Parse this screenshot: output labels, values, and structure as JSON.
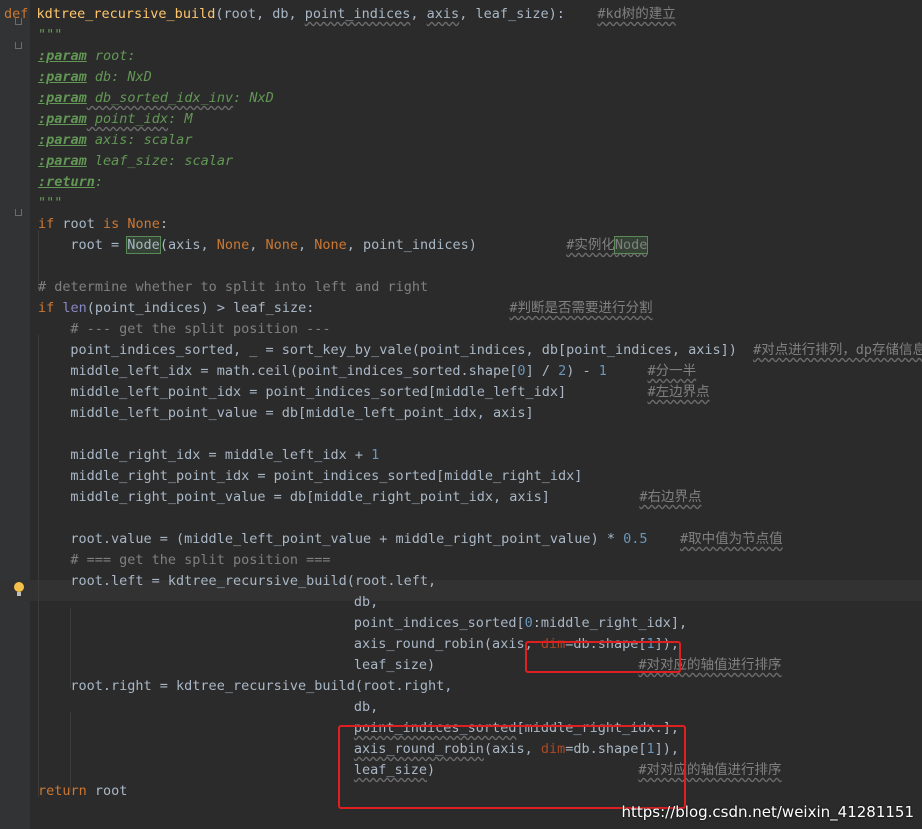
{
  "watermark": "https://blog.csdn.net/weixin_41281151",
  "lines": [
    {
      "id": "def-line",
      "row": 0,
      "indent": 0,
      "segs": [
        {
          "t": "def ",
          "c": "k"
        },
        {
          "t": "kdtree_recursive_build",
          "c": "fn"
        },
        {
          "t": "(root, db, "
        },
        {
          "t": "point_indices",
          "c": "u"
        },
        {
          "t": ", "
        },
        {
          "t": "axis",
          "c": "u"
        },
        {
          "t": ", leaf_size):    "
        },
        {
          "t": "#kd树的建立",
          "c": "cn"
        }
      ]
    },
    {
      "id": "doc-open",
      "row": 1,
      "indent": 0,
      "segs": [
        {
          "t": "\"\"\"",
          "c": "doc"
        }
      ]
    },
    {
      "id": "doc-root",
      "row": 2,
      "indent": 0,
      "segs": [
        {
          "t": ":param",
          "c": "tag"
        },
        {
          "t": " root:",
          "c": "doc"
        }
      ]
    },
    {
      "id": "doc-db",
      "row": 3,
      "indent": 0,
      "segs": [
        {
          "t": ":param",
          "c": "tag"
        },
        {
          "t": " db: NxD",
          "c": "doc"
        }
      ]
    },
    {
      "id": "doc-sorted",
      "row": 4,
      "indent": 0,
      "segs": [
        {
          "t": ":param",
          "c": "tag"
        },
        {
          "t": " db_sorted_idx_inv",
          "c": "doc u"
        },
        {
          "t": ": NxD",
          "c": "doc"
        }
      ]
    },
    {
      "id": "doc-point",
      "row": 5,
      "indent": 0,
      "segs": [
        {
          "t": ":param",
          "c": "tag"
        },
        {
          "t": " point_idx",
          "c": "doc u"
        },
        {
          "t": ": M",
          "c": "doc"
        }
      ]
    },
    {
      "id": "doc-axis",
      "row": 6,
      "indent": 0,
      "segs": [
        {
          "t": ":param",
          "c": "tag"
        },
        {
          "t": " axis: scalar",
          "c": "doc"
        }
      ]
    },
    {
      "id": "doc-leaf",
      "row": 7,
      "indent": 0,
      "segs": [
        {
          "t": ":param",
          "c": "tag"
        },
        {
          "t": " leaf_size: scalar",
          "c": "doc"
        }
      ]
    },
    {
      "id": "doc-return",
      "row": 8,
      "indent": 0,
      "segs": [
        {
          "t": ":return",
          "c": "tag"
        },
        {
          "t": ":",
          "c": "doc"
        }
      ]
    },
    {
      "id": "doc-close",
      "row": 9,
      "indent": 0,
      "segs": [
        {
          "t": "\"\"\"",
          "c": "doc"
        }
      ]
    },
    {
      "id": "if-root",
      "row": 10,
      "indent": 0,
      "segs": [
        {
          "t": "if ",
          "c": "k"
        },
        {
          "t": "root "
        },
        {
          "t": "is None",
          "c": "k"
        },
        {
          "t": ":"
        }
      ]
    },
    {
      "id": "root-node",
      "row": 11,
      "indent": 1,
      "segs": [
        {
          "t": "root = "
        },
        {
          "t": "Node",
          "c": "hl"
        },
        {
          "t": "(axis, "
        },
        {
          "t": "None",
          "c": "k"
        },
        {
          "t": ", "
        },
        {
          "t": "None",
          "c": "k"
        },
        {
          "t": ", "
        },
        {
          "t": "None",
          "c": "k"
        },
        {
          "t": ", point_indices)           "
        },
        {
          "t": "#实例化",
          "c": "cn"
        },
        {
          "t": "Node",
          "c": "cn hl"
        }
      ]
    },
    {
      "id": "cmt-determine",
      "row": 13,
      "indent": 0,
      "segs": [
        {
          "t": "# determine whether to split into left and right",
          "c": "c"
        }
      ]
    },
    {
      "id": "if-len",
      "row": 14,
      "indent": 0,
      "segs": [
        {
          "t": "if ",
          "c": "k"
        },
        {
          "t": "len",
          "c": "bi"
        },
        {
          "t": "(point_indices) > leaf_size:                        "
        },
        {
          "t": "#判断是否需要进行分割",
          "c": "cn"
        }
      ]
    },
    {
      "id": "cmt-get-split",
      "row": 15,
      "indent": 1,
      "segs": [
        {
          "t": "# --- get the split position ---",
          "c": "c"
        }
      ]
    },
    {
      "id": "sorted-line",
      "row": 16,
      "indent": 1,
      "segs": [
        {
          "t": "point_indices_sorted, _ = sort_key_by_vale(point_indices, db[point_indices, axis])  "
        },
        {
          "t": "#对点进行排列，dp存储信息",
          "c": "cn"
        }
      ]
    },
    {
      "id": "mli-line",
      "row": 17,
      "indent": 1,
      "segs": [
        {
          "t": "middle_left_idx = math.ceil(point_indices_sorted.shape["
        },
        {
          "t": "0",
          "c": "num"
        },
        {
          "t": "] / "
        },
        {
          "t": "2",
          "c": "num"
        },
        {
          "t": ") - "
        },
        {
          "t": "1",
          "c": "num"
        },
        {
          "t": "     "
        },
        {
          "t": "#分一半",
          "c": "cn"
        }
      ]
    },
    {
      "id": "mlpi-line",
      "row": 18,
      "indent": 1,
      "segs": [
        {
          "t": "middle_left_point_idx = point_indices_sorted[middle_left_idx]          "
        },
        {
          "t": "#左边界点",
          "c": "cn"
        }
      ]
    },
    {
      "id": "mlpv-line",
      "row": 19,
      "indent": 1,
      "segs": [
        {
          "t": "middle_left_point_value = db[middle_left_point_idx, axis]"
        }
      ]
    },
    {
      "id": "mri-line",
      "row": 21,
      "indent": 1,
      "segs": [
        {
          "t": "middle_right_idx = middle_left_idx + "
        },
        {
          "t": "1",
          "c": "num"
        }
      ]
    },
    {
      "id": "mrpi-line",
      "row": 22,
      "indent": 1,
      "segs": [
        {
          "t": "middle_right_point_idx = point_indices_sorted[middle_right_idx]"
        }
      ]
    },
    {
      "id": "mrpv-line",
      "row": 23,
      "indent": 1,
      "segs": [
        {
          "t": "middle_right_point_value = db[middle_right_point_idx, axis]           "
        },
        {
          "t": "#右边界点",
          "c": "cn"
        }
      ]
    },
    {
      "id": "root-value",
      "row": 25,
      "indent": 1,
      "segs": [
        {
          "t": "root.value = (middle_left_point_value + middle_right_point_value) * "
        },
        {
          "t": "0.5",
          "c": "num"
        },
        {
          "t": "    "
        },
        {
          "t": "#取中值为节点值",
          "c": "cn"
        }
      ]
    },
    {
      "id": "cmt-get-split2",
      "row": 26,
      "indent": 1,
      "segs": [
        {
          "t": "# === get the split position ===",
          "c": "c"
        }
      ]
    },
    {
      "id": "root-left",
      "row": 27,
      "indent": 1,
      "segs": [
        {
          "t": "root.left = kdtree_recursive_build(root.left,"
        }
      ]
    },
    {
      "id": "arg-db1",
      "row": 28,
      "indent": 10,
      "segs": [
        {
          "t": "db,"
        }
      ]
    },
    {
      "id": "arg-pis1",
      "row": 29,
      "indent": 10,
      "segs": [
        {
          "t": "point_indices_sorted["
        },
        {
          "t": "0",
          "c": "num"
        },
        {
          "t": ":middle_right_idx],"
        }
      ]
    },
    {
      "id": "arg-axis1",
      "row": 30,
      "indent": 10,
      "segs": [
        {
          "t": "axis_round_robin(axis, "
        },
        {
          "t": "dim",
          "c": "kw"
        },
        {
          "t": "=db.shape["
        },
        {
          "t": "1",
          "c": "num"
        },
        {
          "t": "]),"
        }
      ]
    },
    {
      "id": "arg-leaf1",
      "row": 31,
      "indent": 10,
      "segs": [
        {
          "t": "leaf_size)                         "
        },
        {
          "t": "#对对应的轴值进行排序",
          "c": "cn"
        }
      ]
    },
    {
      "id": "root-right",
      "row": 32,
      "indent": 1,
      "segs": [
        {
          "t": "root.right = kdtree_recursive_build(root.right,"
        }
      ]
    },
    {
      "id": "arg-db2",
      "row": 33,
      "indent": 10,
      "segs": [
        {
          "t": "db,"
        }
      ]
    },
    {
      "id": "arg-pis2",
      "row": 34,
      "indent": 10,
      "segs": [
        {
          "t": "point_indices_sorted",
          "c": "u"
        },
        {
          "t": "[middle_right_idx:],"
        }
      ]
    },
    {
      "id": "arg-axis2",
      "row": 35,
      "indent": 10,
      "segs": [
        {
          "t": "axis_round_robin",
          "c": "u"
        },
        {
          "t": "(axis, "
        },
        {
          "t": "dim",
          "c": "kw"
        },
        {
          "t": "=db.shape["
        },
        {
          "t": "1",
          "c": "num"
        },
        {
          "t": "]),"
        }
      ]
    },
    {
      "id": "arg-leaf2",
      "row": 36,
      "indent": 10,
      "segs": [
        {
          "t": "leaf_size",
          "c": "u"
        },
        {
          "t": ")                         "
        },
        {
          "t": "#对对应的轴值进行排序",
          "c": "cn"
        }
      ]
    },
    {
      "id": "return-line",
      "row": 37,
      "indent": 0,
      "segs": [
        {
          "t": "return ",
          "c": "k"
        },
        {
          "t": "root"
        }
      ]
    }
  ]
}
